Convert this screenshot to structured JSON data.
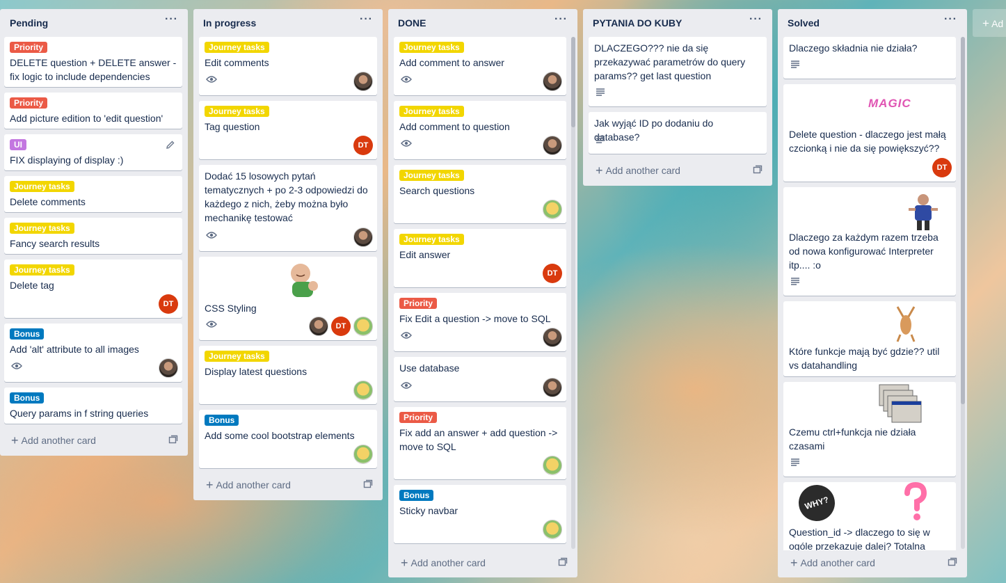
{
  "add_another_card": "Add another card",
  "add_list_label": "Ad",
  "lists": [
    {
      "title": "Pending",
      "cards": [
        {
          "label": "Priority",
          "label_color": "#eb5a46",
          "title": "DELETE question + DELETE answer - fix logic to include dependencies"
        },
        {
          "label": "Priority",
          "label_color": "#eb5a46",
          "title": "Add picture edition to 'edit question'"
        },
        {
          "label": "UI",
          "label_color": "#c377e0",
          "title": "FIX displaying of display :)"
        },
        {
          "label": "Journey tasks",
          "label_color": "#f2d600",
          "title": "Delete comments"
        },
        {
          "label": "Journey tasks",
          "label_color": "#f2d600",
          "title": "Fancy search results"
        },
        {
          "label": "Journey tasks",
          "label_color": "#f2d600",
          "title": "Delete tag",
          "member": "DT"
        },
        {
          "label": "Bonus",
          "label_color": "#0079bf",
          "title": "Add 'alt' attribute to all images"
        },
        {
          "label": "Bonus",
          "label_color": "#0079bf",
          "title": "Query params in f string queries"
        }
      ]
    },
    {
      "title": "In progress",
      "cards": [
        {
          "label": "Journey tasks",
          "label_color": "#f2d600",
          "title": "Edit comments"
        },
        {
          "label": "Journey tasks",
          "label_color": "#f2d600",
          "title": "Tag question",
          "member": "DT"
        },
        {
          "title": "Dodać 15 losowych pytań tematycznych + po 2-3 odpowiedzi do każdego z nich, żeby można było mechanikę testować"
        },
        {
          "title": "CSS Styling",
          "member": "DT"
        },
        {
          "label": "Journey tasks",
          "label_color": "#f2d600",
          "title": "Display latest questions"
        },
        {
          "label": "Bonus",
          "label_color": "#0079bf",
          "title": "Add some cool bootstrap elements"
        }
      ]
    },
    {
      "title": "DONE",
      "cards": [
        {
          "label": "Journey tasks",
          "label_color": "#f2d600",
          "title": "Add comment to answer"
        },
        {
          "label": "Journey tasks",
          "label_color": "#f2d600",
          "title": "Add comment to question"
        },
        {
          "label": "Journey tasks",
          "label_color": "#f2d600",
          "title": "Search questions"
        },
        {
          "label": "Journey tasks",
          "label_color": "#f2d600",
          "title": "Edit answer",
          "member": "DT"
        },
        {
          "label": "Priority",
          "label_color": "#eb5a46",
          "title": "Fix Edit a question -> move to SQL"
        },
        {
          "title": "Use database"
        },
        {
          "label": "Priority",
          "label_color": "#eb5a46",
          "title": "Fix add an answer + add question -> move to SQL"
        },
        {
          "label": "Bonus",
          "label_color": "#0079bf",
          "title": "Sticky navbar"
        }
      ]
    },
    {
      "title": "PYTANIA DO KUBY",
      "cards": [
        {
          "title": "DLACZEGO??? nie da się przekazywać parametrów do query params?? get last question"
        },
        {
          "title": "Jak wyjąć ID po dodaniu do database?"
        }
      ]
    },
    {
      "title": "Solved",
      "cards": [
        {
          "title": "Dlaczego składnia nie działa?"
        },
        {
          "title": "Delete question - dlaczego jest małą czcionką i nie da się powiększyć??",
          "member": "DT",
          "cover_text": "MAGIC"
        },
        {
          "title": "Dlaczego za każdym razem trzeba od nowa konfigurować Interpreter itp.... :o"
        },
        {
          "title": "Które funkcje mają być gdzie?? util vs datahandling"
        },
        {
          "title": "Czemu ctrl+funkcja nie działa czasami"
        },
        {
          "title": "Question_id -> dlaczego to się w ogóle przekazuje dalej? Totalna",
          "cover_text": "WHY?"
        }
      ]
    }
  ]
}
